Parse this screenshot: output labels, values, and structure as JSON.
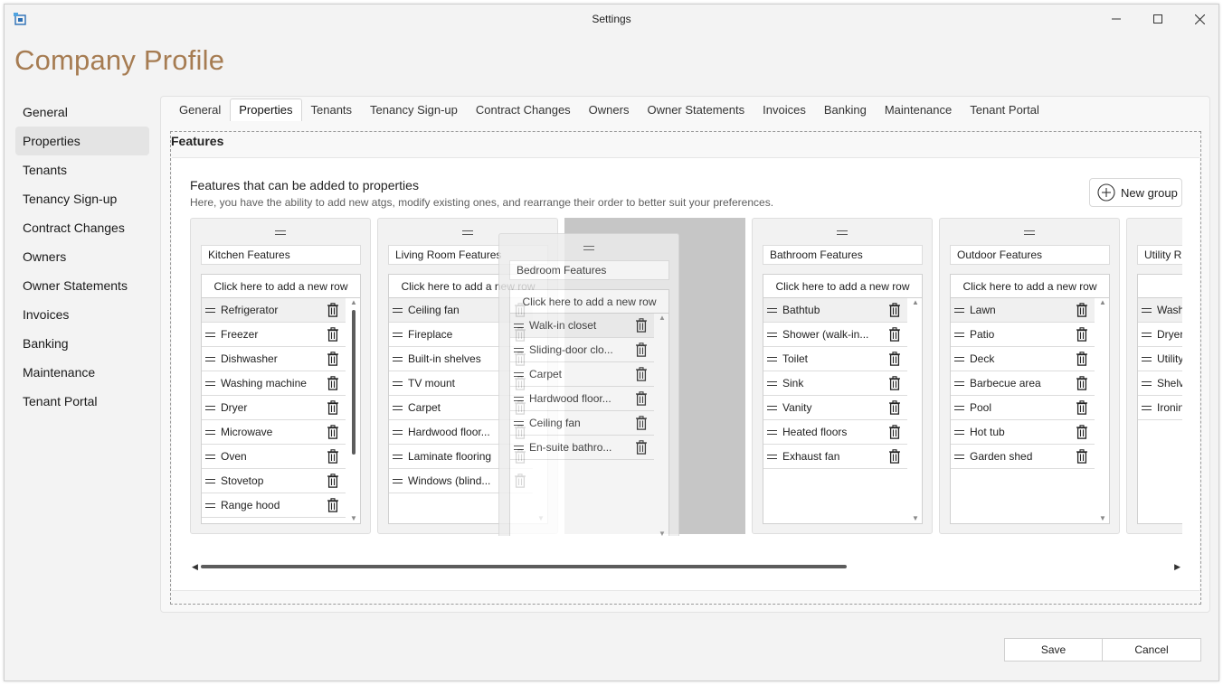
{
  "window": {
    "title": "Settings",
    "icon": "app-icon",
    "controls": [
      "minimize-icon",
      "maximize-icon",
      "close-icon"
    ]
  },
  "page": {
    "title": "Company Profile"
  },
  "sidebar": {
    "selected": "Properties",
    "items": [
      {
        "label": "General"
      },
      {
        "label": "Properties"
      },
      {
        "label": "Tenants"
      },
      {
        "label": "Tenancy Sign-up"
      },
      {
        "label": "Contract Changes"
      },
      {
        "label": "Owners"
      },
      {
        "label": "Owner Statements"
      },
      {
        "label": "Invoices"
      },
      {
        "label": "Banking"
      },
      {
        "label": "Maintenance"
      },
      {
        "label": "Tenant Portal"
      }
    ]
  },
  "tabs": {
    "selected": "Properties",
    "items": [
      {
        "label": "General"
      },
      {
        "label": "Properties"
      },
      {
        "label": "Tenants"
      },
      {
        "label": "Tenancy Sign-up"
      },
      {
        "label": "Contract Changes"
      },
      {
        "label": "Owners"
      },
      {
        "label": "Owner Statements"
      },
      {
        "label": "Invoices"
      },
      {
        "label": "Banking"
      },
      {
        "label": "Maintenance"
      },
      {
        "label": "Tenant Portal"
      }
    ]
  },
  "features": {
    "section_title": "Features",
    "heading": "Features that can be added to properties",
    "description": "Here, you have the ability to add new atgs, modify existing ones, and rearrange their order to better suit your preferences.",
    "new_group_label": "New group",
    "add_row_label": "Click here to add a new row",
    "groups": [
      {
        "name": "Kitchen Features",
        "rows": [
          "Refrigerator",
          "Freezer",
          "Dishwasher",
          "Washing machine",
          "Dryer",
          "Microwave",
          "Oven",
          "Stovetop",
          "Range hood"
        ]
      },
      {
        "name": "Living Room Features",
        "rows": [
          "Ceiling fan",
          "Fireplace",
          "Built-in shelves",
          "TV mount",
          "Carpet",
          "Hardwood floor...",
          "Laminate flooring",
          "Windows (blind..."
        ]
      },
      {
        "name": "Bathroom Features",
        "rows": [
          "Bathtub",
          "Shower (walk-in...",
          "Toilet",
          "Sink",
          "Vanity",
          "Heated floors",
          "Exhaust fan"
        ]
      },
      {
        "name": "Outdoor Features",
        "rows": [
          "Lawn",
          "Patio",
          "Deck",
          "Barbecue area",
          "Pool",
          "Hot tub",
          "Garden shed"
        ]
      },
      {
        "name": "Utility R",
        "add_row_label": "Click h",
        "rows": [
          "Wash",
          "Dryer",
          "Utility",
          "Shelv",
          "Ironin"
        ]
      }
    ],
    "dragging_group": {
      "name": "Bedroom Features",
      "rows": [
        "Walk-in closet",
        "Sliding-door clo...",
        "Carpet",
        "Hardwood floor...",
        "Ceiling fan",
        "En-suite bathro..."
      ]
    }
  },
  "footer": {
    "save_label": "Save",
    "cancel_label": "Cancel"
  }
}
